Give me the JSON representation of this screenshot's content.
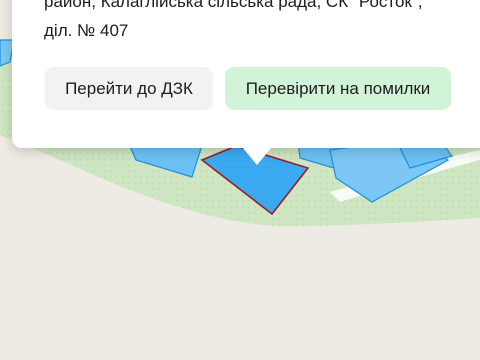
{
  "popup": {
    "address_line_1": "район, Калаглійська сільська рада, СК \"Росток\",",
    "address_line_2": "діл. № 407"
  },
  "buttons": {
    "go_to_dzk": "Перейти до ДЗК",
    "check_errors": "Перевірити на помилки"
  },
  "colors": {
    "parcel_fill": "#3aa9f0",
    "parcel_stroke": "#1e8fe0",
    "selected_parcel_stroke": "#9b1b2e",
    "vegetation": "#cfe6c2",
    "check_button": "#d1f4d8"
  }
}
